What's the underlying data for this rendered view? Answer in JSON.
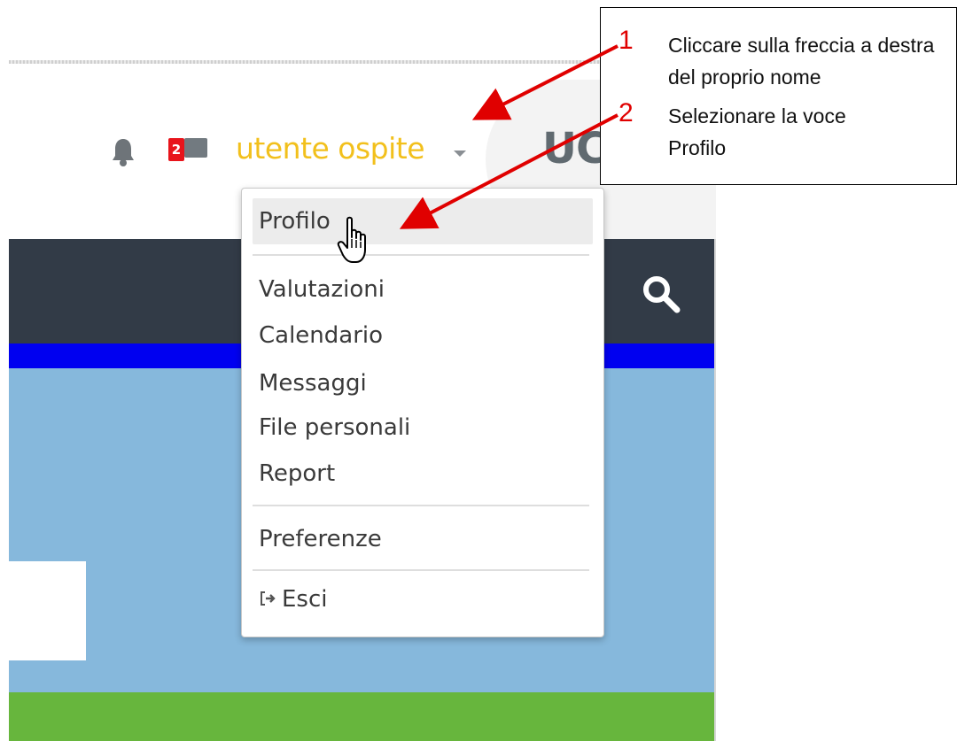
{
  "header": {
    "user_name": "utente ospite",
    "message_count": "2",
    "logo_text": "UC"
  },
  "user_menu": {
    "items": [
      {
        "label": "Profilo"
      },
      {
        "label": "Valutazioni"
      },
      {
        "label": "Calendario"
      },
      {
        "label": "Messaggi"
      },
      {
        "label": "File personali"
      },
      {
        "label": "Report"
      },
      {
        "label": "Preferenze"
      },
      {
        "label": "Esci"
      }
    ]
  },
  "instructions": {
    "steps": [
      {
        "number": "1",
        "text": "Cliccare sulla freccia a destra del proprio nome"
      },
      {
        "number": "2",
        "text": "Selezionare la voce Profilo"
      }
    ]
  },
  "colors": {
    "user_name": "#f2c01c",
    "navbar": "#323b47",
    "blue_strip": "#0000f0",
    "hero": "#86b8dc",
    "green_strip": "#67b63d",
    "annotation": "#e00000"
  }
}
